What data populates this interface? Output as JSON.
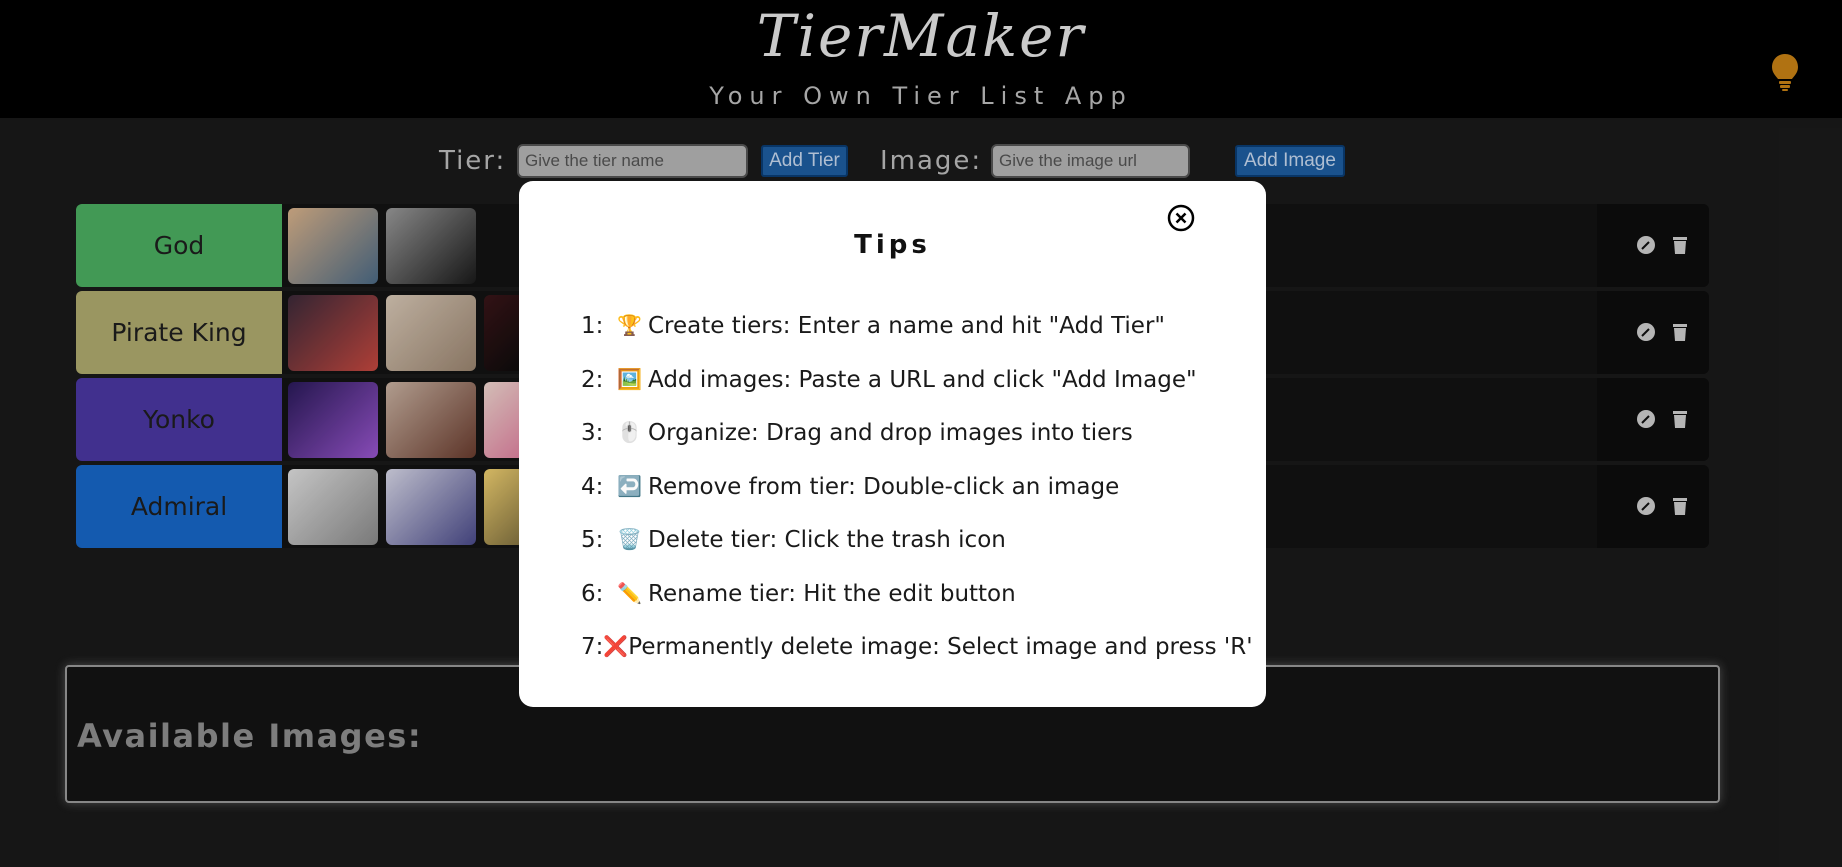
{
  "header": {
    "title": "TierMaker",
    "subtitle": "Your Own Tier List App",
    "bulb_icon": "lightbulb-icon",
    "bulb_color": "#c98215"
  },
  "controls": {
    "tier_label": "Tier:",
    "tier_placeholder": "Give the tier name",
    "add_tier_label": "Add Tier",
    "image_label": "Image:",
    "image_placeholder": "Give the image url",
    "add_image_label": "Add Image"
  },
  "tiers": [
    {
      "name": "God",
      "color": "#4caf61",
      "thumbs": [
        "#d9b28a",
        "#6e6e6e"
      ]
    },
    {
      "name": "Pirate King",
      "color": "#b0ab6f",
      "thumbs": [
        "#b5483f",
        "#c9b8a6",
        "#3a1518"
      ]
    },
    {
      "name": "Yonko",
      "color": "#4b37a2",
      "thumbs": [
        "#4a2a86",
        "#8a5a4a",
        "#e9c6b8"
      ]
    },
    {
      "name": "Admiral",
      "color": "#1767c8",
      "thumbs": [
        "#c8c8c8",
        "#a7a8c0",
        "#d4b060"
      ]
    }
  ],
  "tier_action_icons": [
    "edit-icon",
    "trash-icon"
  ],
  "available": {
    "title": "Available Images:"
  },
  "modal": {
    "title": "Tips",
    "close_icon": "close-circle-icon",
    "tips": [
      {
        "num": "1:",
        "emoji": "🏆",
        "text": "Create tiers: Enter a name and hit \"Add Tier\""
      },
      {
        "num": "2:",
        "emoji": "🖼️",
        "text": "Add images: Paste a URL and click \"Add Image\""
      },
      {
        "num": "3:",
        "emoji": "🖱️",
        "text": "Organize: Drag and drop images into tiers"
      },
      {
        "num": "4:",
        "emoji": "↩️",
        "text": "Remove from tier: Double-click an image"
      },
      {
        "num": "5:",
        "emoji": "🗑️",
        "text": "Delete tier: Click the trash icon"
      },
      {
        "num": "6:",
        "emoji": "✏️",
        "text": "Rename tier: Hit the edit button"
      },
      {
        "num": "7:",
        "emoji": "❌",
        "text": "Permanently delete image: Select image and press 'R'"
      }
    ]
  }
}
